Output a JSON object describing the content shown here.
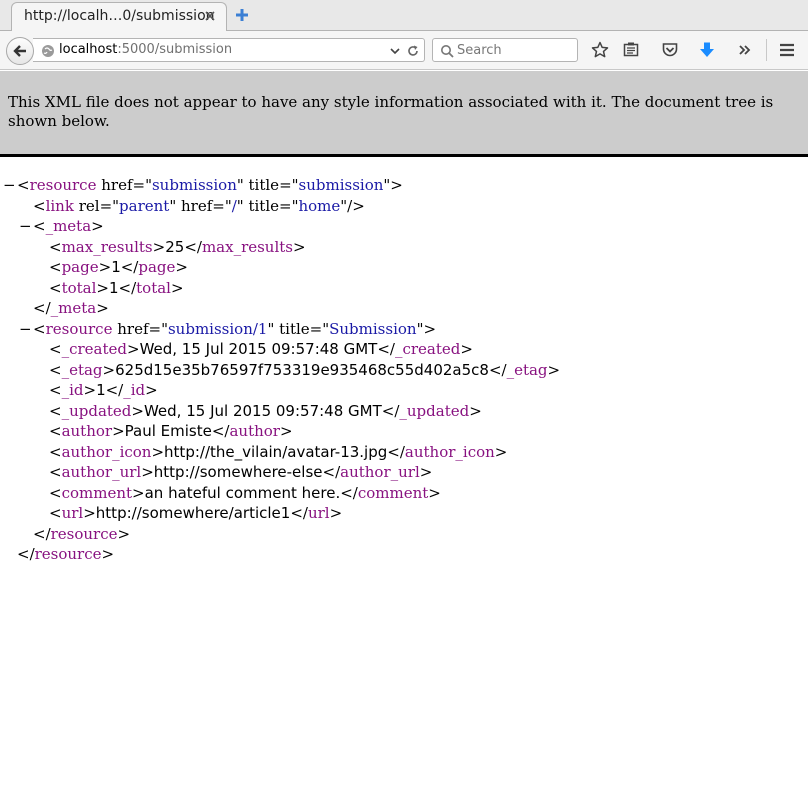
{
  "browser": {
    "tab_title": "http://localh…0/submission",
    "url_host": "localhost",
    "url_rest": ":5000/submission",
    "search_placeholder": "Search"
  },
  "xml_info": "This XML file does not appear to have any style information associated with it. The document tree is shown below.",
  "tree": {
    "root_open": {
      "tag": "resource",
      "attrs": [
        {
          "name": "href",
          "value": "submission"
        },
        {
          "name": "title",
          "value": "submission"
        }
      ]
    },
    "link": {
      "tag": "link",
      "attrs": [
        {
          "name": "rel",
          "value": "parent"
        },
        {
          "name": "href",
          "value": "/"
        },
        {
          "name": "title",
          "value": "home"
        }
      ]
    },
    "meta_tag": "_meta",
    "meta_items": [
      {
        "tag": "max_results",
        "value": "25"
      },
      {
        "tag": "page",
        "value": "1"
      },
      {
        "tag": "total",
        "value": "1"
      }
    ],
    "item_open": {
      "tag": "resource",
      "attrs": [
        {
          "name": "href",
          "value": "submission/1"
        },
        {
          "name": "title",
          "value": "Submission"
        }
      ]
    },
    "item_fields": [
      {
        "tag": "_created",
        "value": "Wed, 15 Jul 2015 09:57:48 GMT"
      },
      {
        "tag": "_etag",
        "value": "625d15e35b76597f753319e935468c55d402a5c8"
      },
      {
        "tag": "_id",
        "value": "1"
      },
      {
        "tag": "_updated",
        "value": "Wed, 15 Jul 2015 09:57:48 GMT"
      },
      {
        "tag": "author",
        "value": "Paul Emiste"
      },
      {
        "tag": "author_icon",
        "value": "http://the_vilain/avatar-13.jpg"
      },
      {
        "tag": "author_url",
        "value": "http://somewhere-else"
      },
      {
        "tag": "comment",
        "value": "an hateful comment here."
      },
      {
        "tag": "url",
        "value": "http://somewhere/article1"
      }
    ],
    "item_close": "resource",
    "root_close": "resource"
  },
  "colors": {
    "tag": "#881280",
    "attr_value": "#1a1aa6",
    "banner_bg": "#cccccc",
    "download_arrow": "#1a8cff"
  },
  "icons": [
    "back-arrow-icon",
    "globe-icon",
    "dropdown-arrow-icon",
    "reload-icon",
    "search-icon",
    "bookmark-star-icon",
    "reading-list-icon",
    "pocket-icon",
    "download-icon",
    "overflow-chevron-icon",
    "menu-icon",
    "close-icon",
    "new-tab-icon",
    "collapse-icon"
  ]
}
